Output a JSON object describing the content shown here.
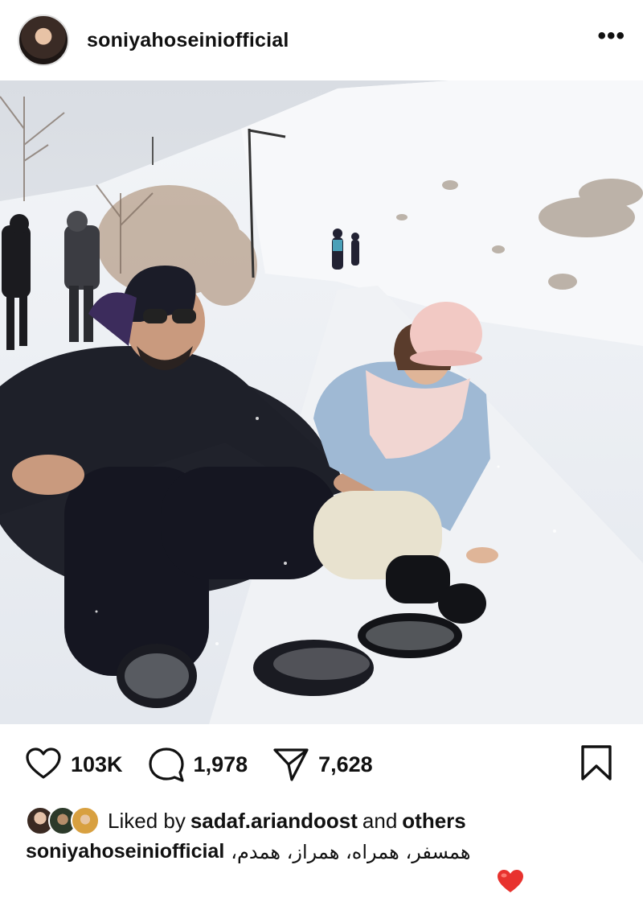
{
  "post": {
    "username": "soniyahoseiniofficial",
    "more_label": "•••"
  },
  "stats": {
    "likes": "103K",
    "comments": "1,978",
    "shares": "7,628"
  },
  "liked_by": {
    "prefix": "Liked by",
    "user": "sadaf.ariandoost",
    "middle": "and",
    "others": "others"
  },
  "caption": {
    "username": "soniyahoseiniofficial",
    "text": "همسفر، همراه، همراز، همدم،"
  },
  "colors": {
    "heart_emoji": "#e8322e",
    "text": "#111111"
  },
  "icons": [
    "avatar",
    "more-icon",
    "heart-icon",
    "comment-icon",
    "share-icon",
    "bookmark-icon"
  ]
}
